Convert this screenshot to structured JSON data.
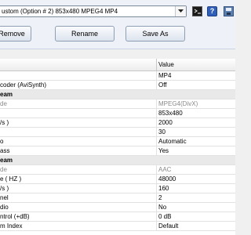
{
  "toolbar": {
    "preset_value": "ustom (Option # 2) 853x480 MPEG4 MP4",
    "remove_label": "Remove",
    "rename_label": "Rename",
    "saveas_label": "Save As",
    "help_label": "?",
    "icons": [
      "chevron-down-icon",
      "command-prompt-icon",
      "help-icon",
      "save-icon"
    ]
  },
  "grid": {
    "value_header": "Value",
    "rows": [
      {
        "prop": "",
        "value": "MP4"
      },
      {
        "prop": "coder (AviSynth)",
        "value": "Off"
      },
      {
        "prop": "eam",
        "value": ""
      },
      {
        "prop": "de",
        "value": "MPEG4(DivX)"
      },
      {
        "prop": "",
        "value": "853x480"
      },
      {
        "prop": "/s )",
        "value": "2000"
      },
      {
        "prop": "",
        "value": "30"
      },
      {
        "prop": "o",
        "value": "Automatic"
      },
      {
        "prop": "ass",
        "value": "Yes"
      },
      {
        "prop": "eam",
        "value": ""
      },
      {
        "prop": "de",
        "value": "AAC"
      },
      {
        "prop": "e ( HZ )",
        "value": "48000"
      },
      {
        "prop": "/s )",
        "value": "160"
      },
      {
        "prop": "nel",
        "value": "2"
      },
      {
        "prop": "dio",
        "value": "No"
      },
      {
        "prop": "ntrol (+dB)",
        "value": "0 dB"
      },
      {
        "prop": "m Index",
        "value": "Default"
      }
    ]
  }
}
